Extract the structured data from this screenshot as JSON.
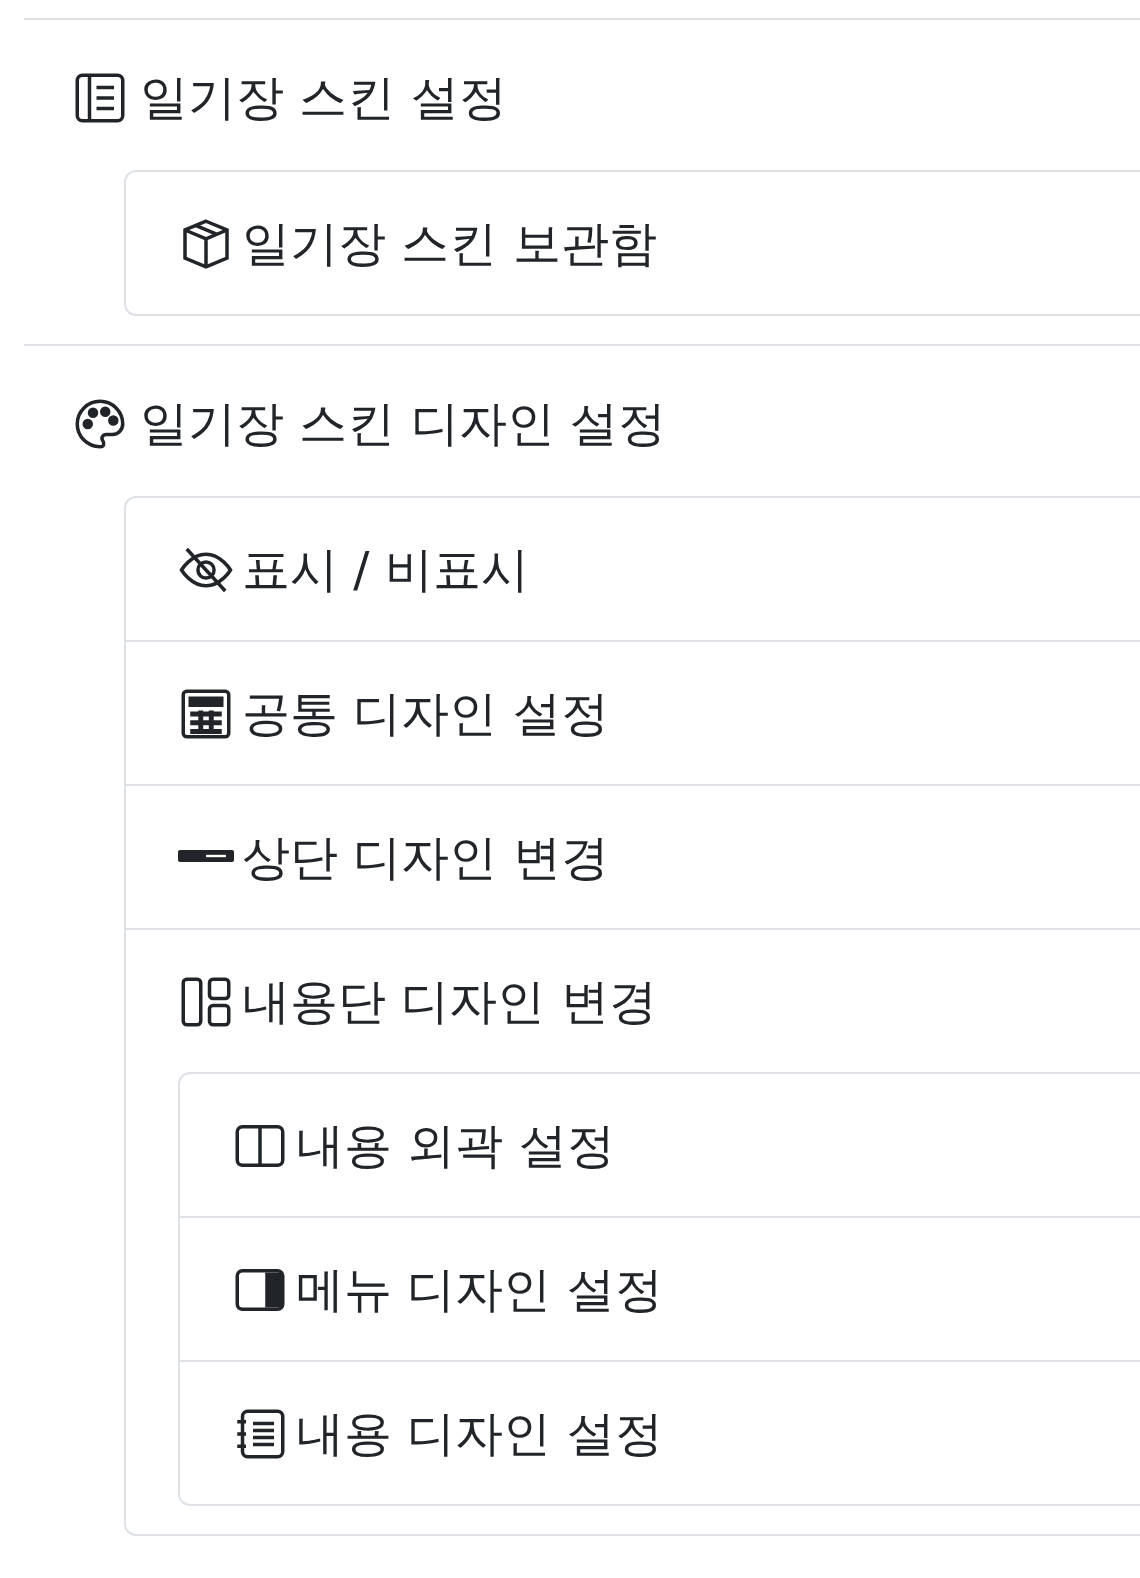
{
  "sections": [
    {
      "label": "일기장 스킨 설정",
      "children": [
        {
          "label": "일기장 스킨 보관함"
        }
      ]
    },
    {
      "label": "일기장 스킨 디자인 설정",
      "children": [
        {
          "label": "표시 / 비표시"
        },
        {
          "label": "공통 디자인 설정"
        },
        {
          "label": "상단 디자인 변경"
        },
        {
          "label": "내용단 디자인 변경",
          "children": [
            {
              "label": "내용 외곽 설정"
            },
            {
              "label": "메뉴 디자인 설정"
            },
            {
              "label": "내용 디자인 설정"
            }
          ]
        }
      ]
    }
  ]
}
